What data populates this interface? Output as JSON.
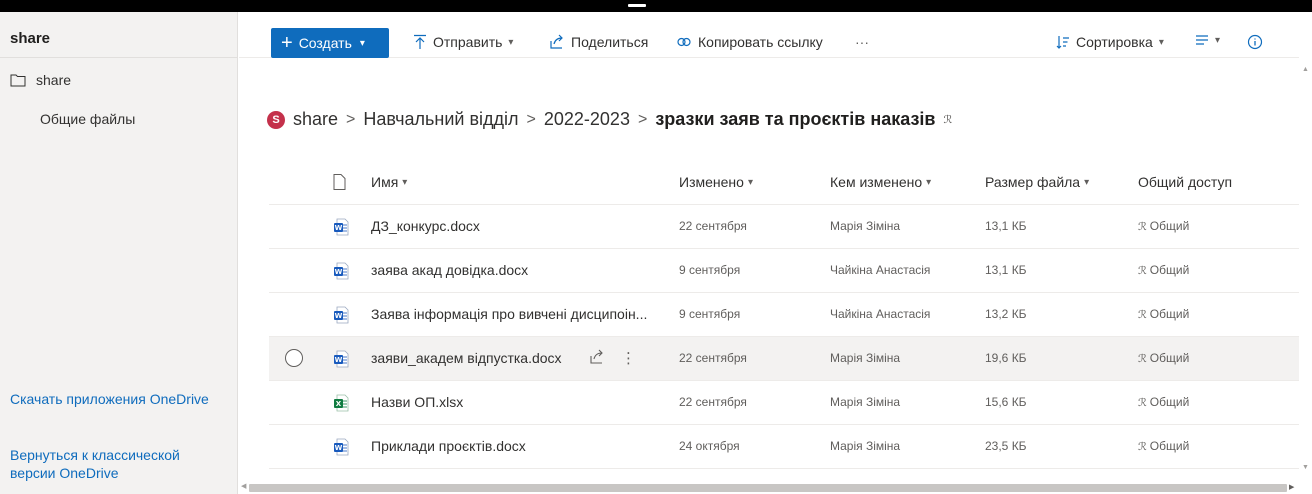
{
  "sidebar": {
    "site_title": "share",
    "nav_share": "share",
    "nav_files": "Общие файлы",
    "link_download": "Скачать приложения OneDrive",
    "link_classic": "Вернуться к классической версии OneDrive"
  },
  "command_bar": {
    "create": "Создать",
    "upload": "Отправить",
    "share": "Поделиться",
    "copy_link": "Копировать ссылку",
    "more": "···",
    "sort": "Сортировка"
  },
  "breadcrumb": {
    "site_initial": "S",
    "items": [
      "share",
      "Навчальний відділ",
      "2022-2023"
    ],
    "current": "зразки заяв та проєктів наказів",
    "shared_icon": "ℛ"
  },
  "columns": {
    "name": "Имя",
    "modified": "Изменено",
    "modified_by": "Кем изменено",
    "size": "Размер файла",
    "sharing": "Общий доступ"
  },
  "files": [
    {
      "name": "ДЗ_конкурс.docx",
      "type": "word",
      "modified": "22 сентября",
      "modified_by": "Марія Зіміна",
      "size": "13,1 КБ",
      "sharing": "Общий"
    },
    {
      "name": "заява акад довідка.docx",
      "type": "word",
      "modified": "9 сентября",
      "modified_by": "Чайкіна Анастасія",
      "size": "13,1 КБ",
      "sharing": "Общий"
    },
    {
      "name": "Заява інформація про вивчені дисципоін...",
      "type": "word",
      "modified": "9 сентября",
      "modified_by": "Чайкіна Анастасія",
      "size": "13,2 КБ",
      "sharing": "Общий"
    },
    {
      "name": "заяви_академ відпустка.docx",
      "type": "word",
      "modified": "22 сентября",
      "modified_by": "Марія Зіміна",
      "size": "19,6 КБ",
      "sharing": "Общий"
    },
    {
      "name": "Назви ОП.xlsx",
      "type": "excel",
      "modified": "22 сентября",
      "modified_by": "Марія Зіміна",
      "size": "15,6 КБ",
      "sharing": "Общий"
    },
    {
      "name": "Приклади проєктів.docx",
      "type": "word",
      "modified": "24 октября",
      "modified_by": "Марія Зіміна",
      "size": "23,5 КБ",
      "sharing": "Общий"
    }
  ],
  "colors": {
    "accent": "#0f6cbd",
    "word": "#185abd",
    "excel": "#107c41",
    "site_badge": "#c4314b"
  }
}
